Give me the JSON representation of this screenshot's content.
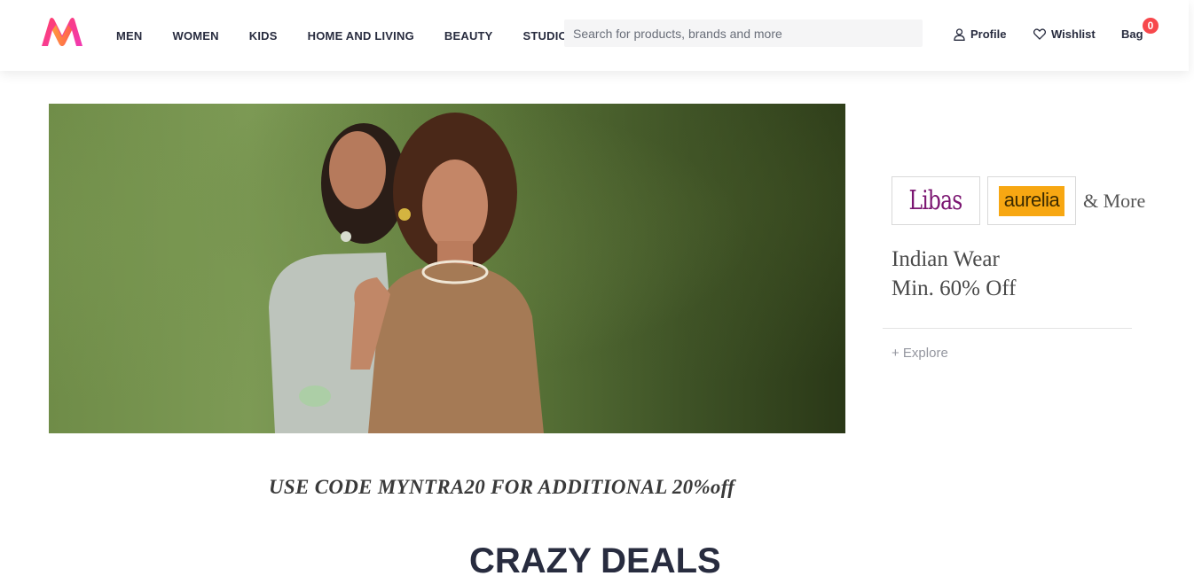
{
  "brand": {
    "logo_icon": "myntra-logo-icon",
    "accent": "#f7484c"
  },
  "nav": {
    "items": [
      {
        "label": "MEN"
      },
      {
        "label": "WOMEN"
      },
      {
        "label": "KIDS"
      },
      {
        "label": "HOME AND LIVING"
      },
      {
        "label": "BEAUTY"
      },
      {
        "label": "STUDIO"
      }
    ]
  },
  "search": {
    "placeholder": "Search for products, brands and more",
    "value": ""
  },
  "actions": {
    "profile": {
      "label": "Profile",
      "icon": "user-icon"
    },
    "wishlist": {
      "label": "Wishlist",
      "icon": "heart-icon"
    },
    "bag": {
      "label": "Bag",
      "count": "0"
    }
  },
  "banner": {
    "brands": [
      "Libas",
      "aurelia"
    ],
    "more_label": "& More",
    "offer_line1": "Indian Wear",
    "offer_line2": "Min. 60% Off",
    "explore_label": "+ Explore"
  },
  "promo": {
    "text": "USE CODE MYNTRA20 FOR ADDITIONAL 20%off"
  },
  "section": {
    "title": "CRAZY DEALS"
  }
}
